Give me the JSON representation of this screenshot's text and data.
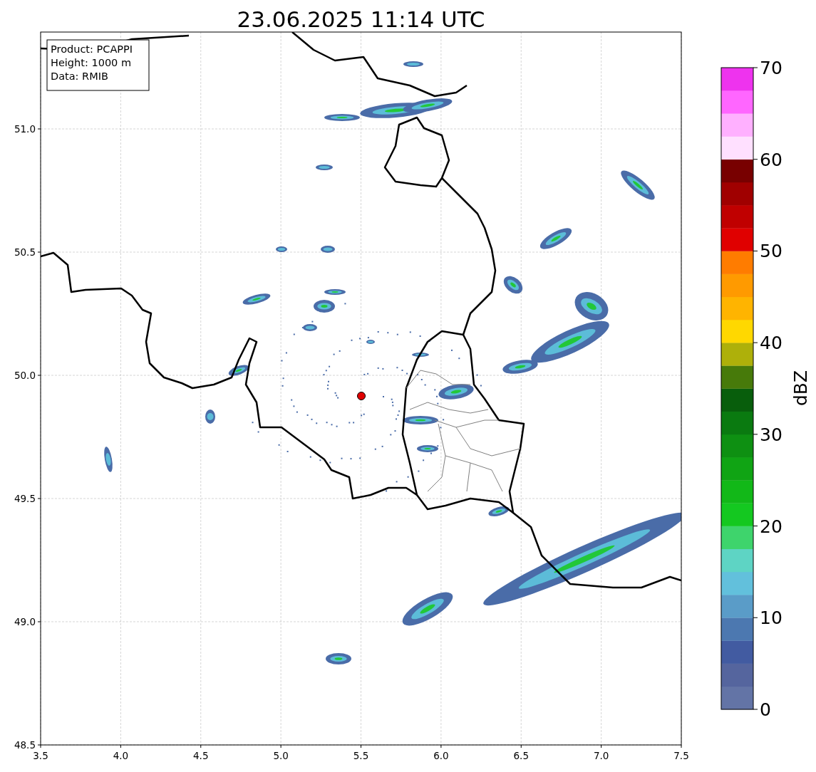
{
  "title": "23.06.2025 11:14 UTC",
  "info_box": [
    "Product: PCAPPI",
    "Height: 1000 m",
    "Data: RMIB"
  ],
  "axes": {
    "xticks": [
      "3.5",
      "4.0",
      "4.5",
      "5.0",
      "5.5",
      "6.0",
      "6.5",
      "7.0",
      "7.5"
    ],
    "yticks": [
      "51.0",
      "50.5",
      "50.0",
      "49.5",
      "49.0",
      "48.5"
    ]
  },
  "colorbar": {
    "label": "dBZ",
    "ticks": [
      "70",
      "60",
      "50",
      "40",
      "30",
      "20",
      "10",
      "0"
    ],
    "segments": [
      {
        "color": "#6374a6"
      },
      {
        "color": "#55659e"
      },
      {
        "color": "#425ba1"
      },
      {
        "color": "#4c78b0"
      },
      {
        "color": "#5a9cc8"
      },
      {
        "color": "#62c0dc"
      },
      {
        "color": "#5ed4c4"
      },
      {
        "color": "#3ed46c"
      },
      {
        "color": "#14c820"
      },
      {
        "color": "#12b818"
      },
      {
        "color": "#10a414"
      },
      {
        "color": "#0e9012"
      },
      {
        "color": "#0a7a10"
      },
      {
        "color": "#085e0c"
      },
      {
        "color": "#477a0a"
      },
      {
        "color": "#aeb00a"
      },
      {
        "color": "#ffd800"
      },
      {
        "color": "#ffb400"
      },
      {
        "color": "#ff9a00"
      },
      {
        "color": "#ff7c00"
      },
      {
        "color": "#e00000"
      },
      {
        "color": "#c00000"
      },
      {
        "color": "#a00000"
      },
      {
        "color": "#780000"
      },
      {
        "color": "#ffe0ff"
      },
      {
        "color": "#ffb0ff"
      },
      {
        "color": "#ff66ff"
      },
      {
        "color": "#ee33ee"
      }
    ]
  }
}
